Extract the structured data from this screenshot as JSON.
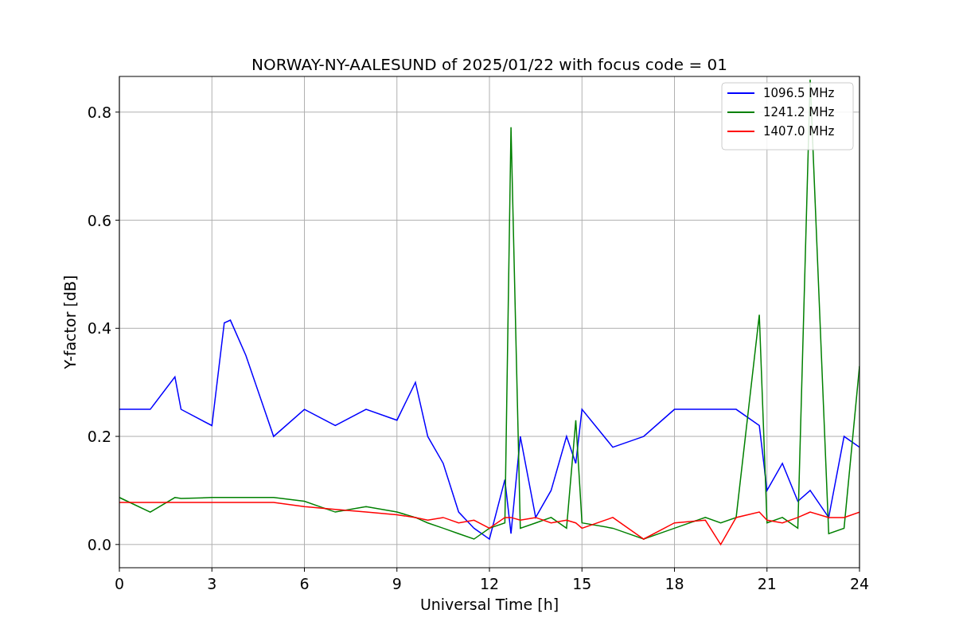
{
  "chart_data": {
    "type": "line",
    "title": "NORWAY-NY-AALESUND of 2025/01/22 with focus code = 01",
    "xlabel": "Universal Time [h]",
    "ylabel": "Y-factor [dB]",
    "x": [
      0,
      1,
      1.8,
      2,
      3,
      3.4,
      3.6,
      4.1,
      5,
      6,
      7,
      8,
      9,
      9.6,
      10,
      10.5,
      11,
      11.5,
      12,
      12.5,
      12.7,
      13,
      13.5,
      14,
      14.5,
      14.8,
      15,
      16,
      17,
      18,
      19,
      19.5,
      20,
      20.75,
      21,
      21.5,
      22,
      22.4,
      23,
      23.5,
      24
    ],
    "series": [
      {
        "name": "1096.5 MHz",
        "color": "#0000ff",
        "values": [
          0.25,
          0.25,
          0.31,
          0.25,
          0.22,
          0.41,
          0.415,
          0.35,
          0.2,
          0.25,
          0.22,
          0.25,
          0.23,
          0.3,
          0.2,
          0.15,
          0.06,
          0.03,
          0.01,
          0.12,
          0.02,
          0.2,
          0.05,
          0.1,
          0.2,
          0.15,
          0.25,
          0.18,
          0.2,
          0.25,
          0.25,
          0.25,
          0.25,
          0.22,
          0.1,
          0.15,
          0.08,
          0.1,
          0.05,
          0.2,
          0.18
        ]
      },
      {
        "name": "1241.2 MHz",
        "color": "#008000",
        "values": [
          0.087,
          0.06,
          0.087,
          0.085,
          0.087,
          0.087,
          0.087,
          0.087,
          0.087,
          0.08,
          0.06,
          0.07,
          0.06,
          0.05,
          0.04,
          0.03,
          0.02,
          0.01,
          0.03,
          0.04,
          0.772,
          0.03,
          0.04,
          0.05,
          0.03,
          0.23,
          0.04,
          0.03,
          0.01,
          0.03,
          0.05,
          0.04,
          0.05,
          0.425,
          0.04,
          0.05,
          0.03,
          0.86,
          0.02,
          0.03,
          0.33
        ]
      },
      {
        "name": "1407.0 MHz",
        "color": "#ff0000",
        "values": [
          0.078,
          0.078,
          0.078,
          0.078,
          0.078,
          0.078,
          0.078,
          0.078,
          0.078,
          0.07,
          0.065,
          0.06,
          0.055,
          0.05,
          0.045,
          0.05,
          0.04,
          0.045,
          0.03,
          0.05,
          0.05,
          0.045,
          0.05,
          0.04,
          0.045,
          0.04,
          0.03,
          0.05,
          0.01,
          0.04,
          0.045,
          0.0,
          0.05,
          0.06,
          0.045,
          0.04,
          0.05,
          0.06,
          0.05,
          0.05,
          0.06
        ]
      }
    ],
    "grid": true,
    "legend": "upper right",
    "xlim": [
      0,
      24
    ],
    "ylim": [
      -0.043,
      0.866
    ],
    "xticks": [
      0,
      3,
      6,
      9,
      12,
      15,
      18,
      21,
      24
    ],
    "yticks": [
      {
        "value": 0,
        "label": "0.0"
      },
      {
        "value": 0.2,
        "label": "0.2"
      },
      {
        "value": 0.4,
        "label": "0.4"
      },
      {
        "value": 0.6,
        "label": "0.6"
      },
      {
        "value": 0.8,
        "label": "0.8"
      }
    ]
  }
}
